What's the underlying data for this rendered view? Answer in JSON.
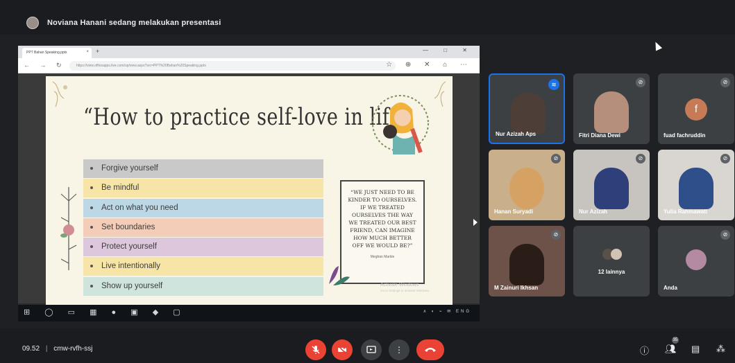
{
  "presenter_banner": {
    "text": "Noviana Hanani sedang melakukan presentasi"
  },
  "browser": {
    "tab_title": "PPT Bahan Speaking.pptx",
    "tab_close": "×",
    "new_tab": "+",
    "window_controls": "—  □  ✕",
    "nav_icons": "←  →  ↻",
    "url": "https://view.officeapps.live.com/op/view.aspx?src=PPT%20Bahan%20Speaking.pptx",
    "addr_icons": "☆  ⊕  ✕  ⌂  ⋯"
  },
  "slide": {
    "title": "“How to practice self-love in life”",
    "items": [
      "Forgive yourself",
      "Be mindful",
      "Act on what you need",
      "Set boundaries",
      "Protect yourself",
      "Live intentionally",
      "Show up yourself"
    ],
    "quote": "“We just need to be kinder to ourselves. If we treated ourselves the way we treated our best friend, can imagine how much better off we would be?”",
    "quote_author": "Meghan Markle"
  },
  "activation_watermark": {
    "line1": "Activate Windows",
    "line2": "Go to Settings to activate Windows."
  },
  "taskbar": {
    "icons": "⊞ ◯ ▭ ▦ ● ▣ ◆ ▢",
    "tray": "∧ ◐ ⌁ ✉ ENG"
  },
  "participants": [
    {
      "name": "Nur Azizah Aps",
      "status": "speaking",
      "face_color": "#6b5a4f",
      "bg": "#8fa3b8"
    },
    {
      "name": "Fitri Diana Dewi",
      "status": "muted",
      "face_color": "#b58f7c",
      "bg": "#c2a892"
    },
    {
      "name": "fuad fachruddin",
      "status": "muted",
      "initial": "f",
      "bg": "#3c4043"
    },
    {
      "name": "Hanan Suryadi",
      "status": "muted",
      "face_color": "#d6a264",
      "bg": "#c9b08a"
    },
    {
      "name": "Nur Azizah",
      "status": "muted",
      "face_color": "#2e3f7a",
      "bg": "#c7c3bf"
    },
    {
      "name": "Yulia Rahmawati",
      "status": "muted",
      "face_color": "#2f4f8a",
      "bg": "#d9d6d2"
    },
    {
      "name": "M Zainuri Ikhsan",
      "status": "muted",
      "face_color": "#2a1d18",
      "bg": "#6c5248"
    },
    {
      "name": "12 lainnya",
      "status": "more",
      "bg": "#3c4043"
    },
    {
      "name": "Anda",
      "status": "muted",
      "face_color": "#b48aa2",
      "bg": "#3c4043"
    }
  ],
  "bottom_bar": {
    "time": "09.52",
    "meeting_code": "cmw-rvfh-ssj",
    "participants_count": "35"
  },
  "colors": {
    "red": "#ea4335",
    "speaking_blue": "#1a73e8",
    "tile_gray": "#3c4043"
  }
}
